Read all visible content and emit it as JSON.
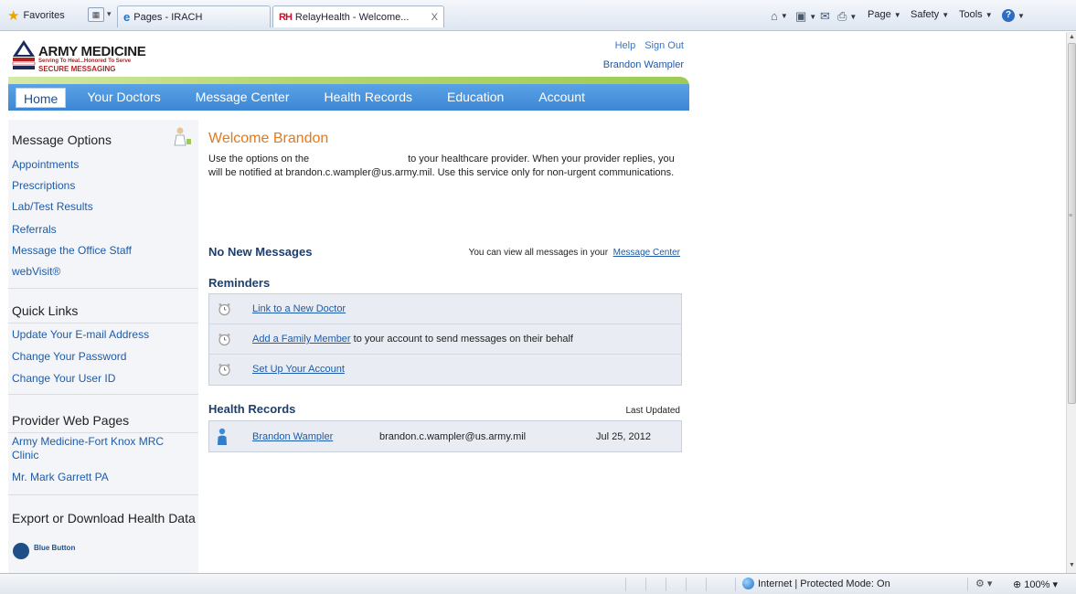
{
  "browser": {
    "favorites": "Favorites",
    "tabs": [
      {
        "title": "Pages - IRACH",
        "close": ""
      },
      {
        "title": "RelayHealth - Welcome...",
        "close": "X"
      }
    ],
    "commands": {
      "page": "Page",
      "safety": "Safety",
      "tools": "Tools"
    }
  },
  "header": {
    "logo_title": "ARMY MEDICINE",
    "logo_tagline": "Serving To Heal...Honored To Serve",
    "logo_subtitle": "SECURE MESSAGING",
    "help": "Help",
    "signout": "Sign Out",
    "user": "Brandon Wampler"
  },
  "nav": {
    "items": [
      "Home",
      "Your Doctors",
      "Message Center",
      "Health Records",
      "Education",
      "Account"
    ]
  },
  "sidebar": {
    "message_options": {
      "heading": "Message Options",
      "links": [
        "Appointments",
        "Prescriptions",
        "Lab/Test Results",
        "Referrals",
        "Message the Office Staff",
        "webVisit®"
      ]
    },
    "quick_links": {
      "heading": "Quick Links",
      "links": [
        "Update Your E-mail Address",
        "Change Your Password",
        "Change Your User ID"
      ]
    },
    "provider_pages": {
      "heading": "Provider Web Pages",
      "links": [
        "Army Medicine-Fort Knox MRC Clinic",
        "Mr. Mark Garrett PA"
      ]
    },
    "export": {
      "heading": "Export or Download Health Data",
      "blue_button": "Blue Button"
    }
  },
  "main": {
    "welcome": "Welcome Brandon",
    "intro_part1": "Use the options on the",
    "intro_part2": "to your healthcare provider. When your provider replies, you will be notified at brandon.c.wampler@us.army.mil. Use this service only for non-urgent communications.",
    "no_messages": {
      "heading": "No New Messages",
      "note": "You can view all messages in your",
      "link": "Message Center"
    },
    "reminders": {
      "heading": "Reminders",
      "items": [
        {
          "link": "Link to a New Doctor",
          "rest": ""
        },
        {
          "link": "Add a Family Member",
          "rest": " to your account to send messages on their behalf"
        },
        {
          "link": "Set Up Your Account",
          "rest": ""
        }
      ]
    },
    "health_records": {
      "heading": "Health Records",
      "last_updated_label": "Last Updated",
      "rows": [
        {
          "name": "Brandon Wampler",
          "email": "brandon.c.wampler@us.army.mil",
          "date": "Jul 25, 2012"
        }
      ]
    }
  },
  "statusbar": {
    "zone": "Internet | Protected Mode: On",
    "zoom": "100%"
  },
  "colors": {
    "nav_blue": "#3c86d5",
    "accent_orange": "#e07a1f",
    "link_blue": "#1e5ba8",
    "heading_navy": "#1d3f6e"
  }
}
